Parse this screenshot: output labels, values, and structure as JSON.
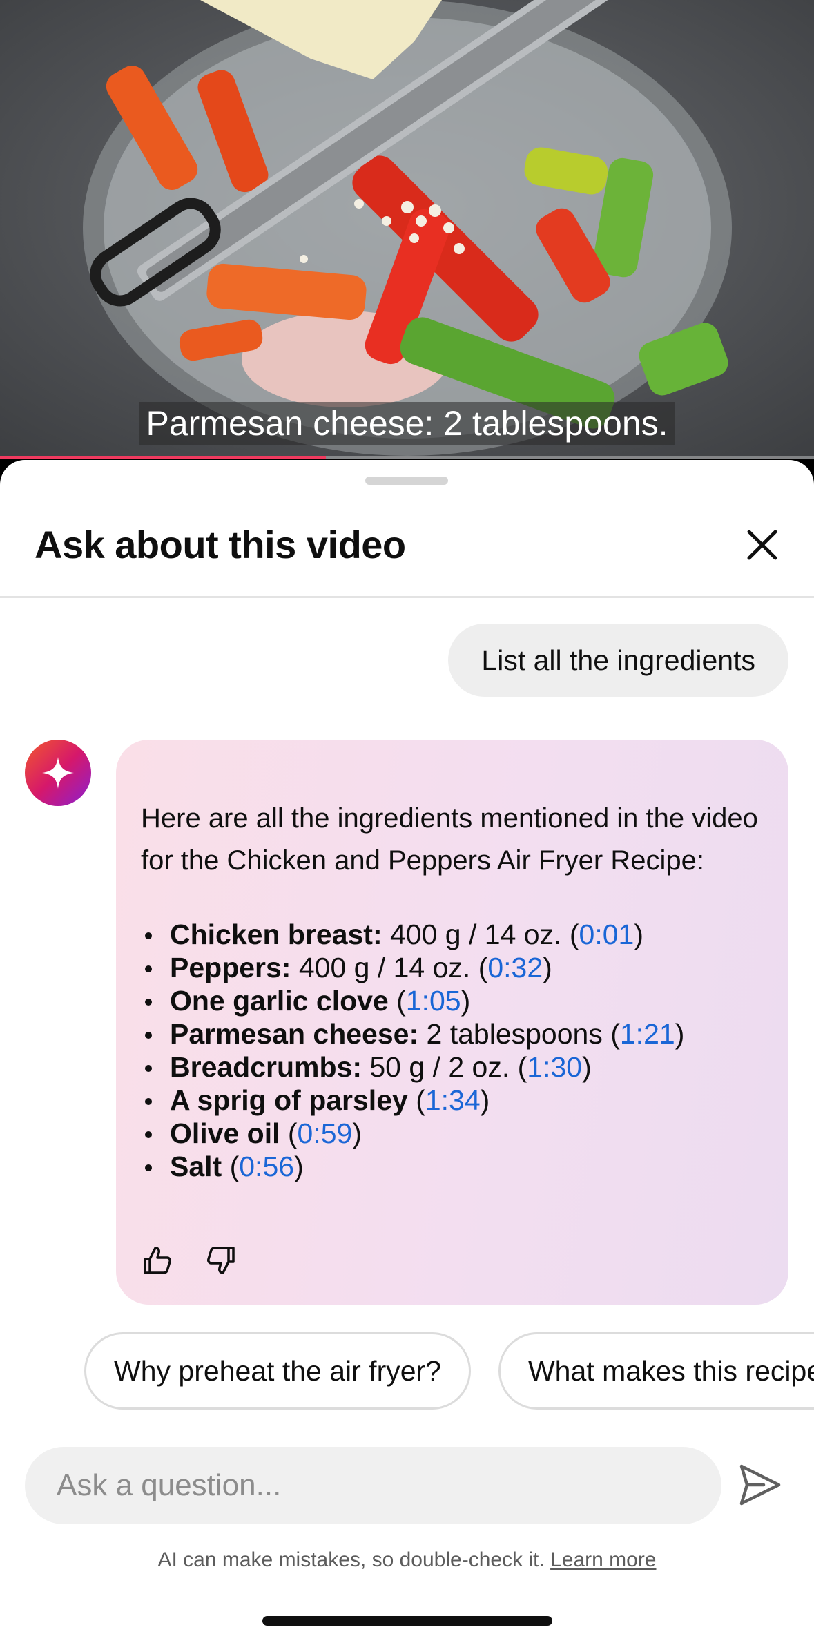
{
  "video": {
    "caption": "Parmesan cheese: 2 tablespoons.",
    "progress_fraction": 0.4
  },
  "sheet": {
    "title": "Ask about this video",
    "close_icon": "close-icon"
  },
  "conversation": {
    "user_message": "List all the ingredients",
    "assistant_intro": "Here are all the ingredients mentioned in the video for the Chicken and Peppers Air Fryer Recipe:",
    "ingredients": [
      {
        "name": "Chicken breast:",
        "bold": true,
        "detail": " 400 g / 14 oz. (",
        "timestamp": "0:01",
        "close": ")"
      },
      {
        "name": "Peppers:",
        "bold": true,
        "detail": " 400 g / 14 oz. (",
        "timestamp": "0:32",
        "close": ")"
      },
      {
        "name": "One garlic clove",
        "bold": true,
        "detail": " (",
        "timestamp": "1:05",
        "close": ")"
      },
      {
        "name": "Parmesan cheese:",
        "bold": true,
        "detail": " 2 tablespoons (",
        "timestamp": "1:21",
        "close": ")"
      },
      {
        "name": "Breadcrumbs:",
        "bold": true,
        "detail": " 50 g / 2 oz. (",
        "timestamp": "1:30",
        "close": ")"
      },
      {
        "name": "A sprig of parsley",
        "bold": true,
        "detail": " (",
        "timestamp": "1:34",
        "close": ")"
      },
      {
        "name": "Olive oil",
        "bold": true,
        "detail": " (",
        "timestamp": "0:59",
        "close": ")"
      },
      {
        "name": "Salt",
        "bold": true,
        "detail": " (",
        "timestamp": "0:56",
        "close": ")"
      }
    ],
    "feedback_icons": [
      "thumbs-up-icon",
      "thumbs-down-icon"
    ]
  },
  "suggestions": [
    "Why preheat the air fryer?",
    "What makes this recipe"
  ],
  "input": {
    "placeholder": "Ask a question...",
    "value": ""
  },
  "disclaimer": {
    "text": "AI can make mistakes, so double-check it. ",
    "link": "Learn more"
  },
  "colors": {
    "accent_link": "#1a66d6",
    "progress": "#f03a5f",
    "avatar_gradient": [
      "#f25a2c",
      "#d6186a",
      "#8a1fd1"
    ]
  }
}
